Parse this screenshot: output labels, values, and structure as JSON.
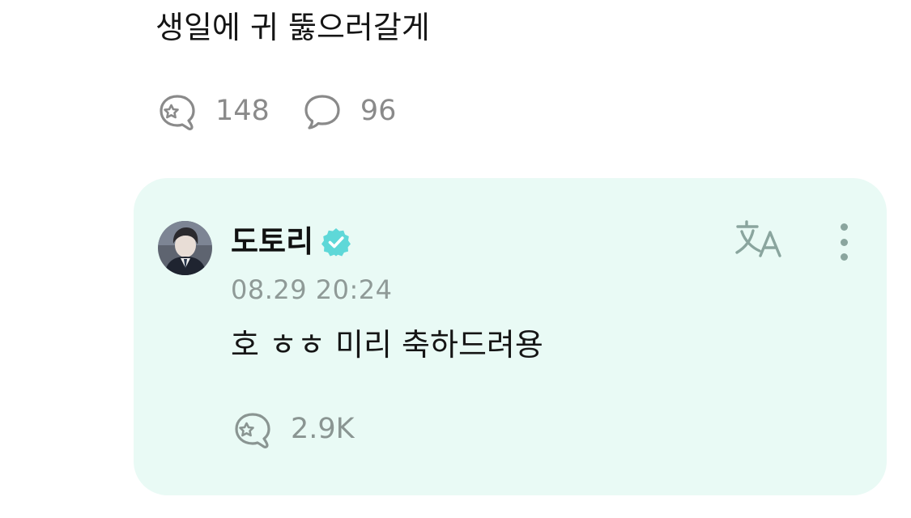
{
  "post": {
    "text": "생일에 귀 뚫으러갈게",
    "like_count": "148",
    "comment_count": "96"
  },
  "reply": {
    "author": "도토리",
    "verified": true,
    "timestamp": "08.29 20:24",
    "text": "호 ㅎㅎ 미리 축하드려용",
    "like_count": "2.9K",
    "card_color": "#e9faf5",
    "verified_color": "#5ed8d8"
  },
  "icons": {
    "like": "heart-star-bubble-icon",
    "comment": "speech-bubble-icon",
    "translate": "translate-icon",
    "more": "more-vertical-icon",
    "verified": "verified-badge-icon"
  }
}
